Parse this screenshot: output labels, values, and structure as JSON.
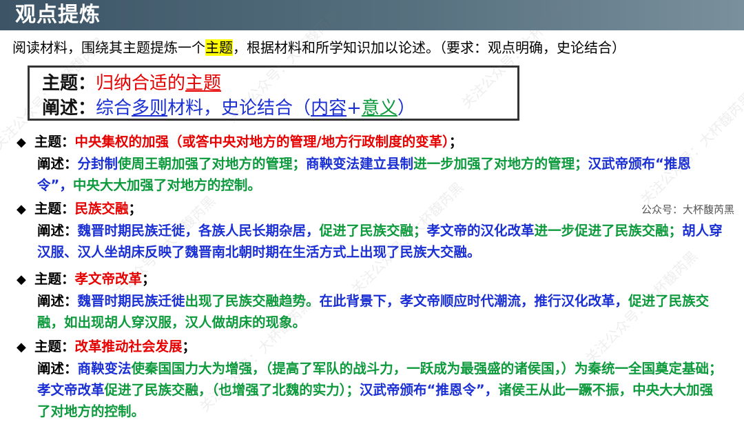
{
  "header": {
    "title": "观点提炼"
  },
  "intro": {
    "before": "阅读材料，围绕其主题提炼一个",
    "highlight": "主题",
    "after": "，根据材料和所学知识加以论述。（要求：观点明确，史论结合）"
  },
  "requirements_box": {
    "line1_label": "主题：",
    "line1_pre": "归纳合适的",
    "line1_underlined": "主题",
    "line2_label": "阐述：",
    "line2_a": "综合",
    "line2_b": "多则",
    "line2_c": "材料，史论结合（",
    "line2_d": "内容",
    "line2_e": "+",
    "line2_f": "意义",
    "line2_g": "）"
  },
  "points": [
    {
      "theme_label": "主题：",
      "theme": "中央集权的加强（或答中央对地方的管理/地方行政制度的变革）",
      "theme_end": "；",
      "explain_label": "阐述：",
      "segments": [
        {
          "t": "分封制",
          "c": "blue"
        },
        {
          "t": "使周王朝加强了对地方的管理；",
          "c": "green"
        },
        {
          "t": "商鞅变法建立县制",
          "c": "blue"
        },
        {
          "t": "进一步加强了对地方的管理；",
          "c": "green"
        },
        {
          "t": "汉武帝颁布“推恩令”，",
          "c": "blue"
        },
        {
          "t": "中央大大加强了对地方的控制。",
          "c": "green"
        }
      ]
    },
    {
      "theme_label": "主题：",
      "theme": "民族交融",
      "theme_end": "；",
      "explain_label": "阐述：",
      "segments": [
        {
          "t": "魏晋时期民族迁徙，各族人民长期杂居，",
          "c": "blue"
        },
        {
          "t": "促进了民族交融；",
          "c": "green"
        },
        {
          "t": "孝文帝的汉化改革",
          "c": "blue"
        },
        {
          "t": "进一步促进了民族交融；",
          "c": "green"
        },
        {
          "t": "胡人穿汉服、汉人坐胡床反映了魏晋南北朝时期在生活方式上出现了民族大交融。",
          "c": "blue"
        }
      ]
    },
    {
      "theme_label": "主题：",
      "theme": "孝文帝改革",
      "theme_end": "；",
      "explain_label": "阐述：",
      "segments": [
        {
          "t": "魏晋时期民族迁徙",
          "c": "blue"
        },
        {
          "t": "出现了民族交融趋势。",
          "c": "green"
        },
        {
          "t": "在此背景下，孝文帝顺应时代潮流，推行汉化改革，",
          "c": "blue"
        },
        {
          "t": "促进了民族交融，如出现胡人穿汉服，汉人做胡床的现象。",
          "c": "green"
        }
      ]
    },
    {
      "theme_label": "主题：",
      "theme": "改革推动社会发展",
      "theme_end": "；",
      "explain_label": "阐述：",
      "segments": [
        {
          "t": "商鞅变法",
          "c": "blue"
        },
        {
          "t": "使秦国国力大为增强，（提高了军队的战斗力，一跃成为最强盛的诸侯国，）为秦统一全国奠定基础；",
          "c": "green"
        },
        {
          "t": "孝文帝改革",
          "c": "blue"
        },
        {
          "t": "促进了民族交融，（也增强了北魏的实力）；",
          "c": "green"
        },
        {
          "t": "汉武帝颁布“推恩令”，",
          "c": "blue"
        },
        {
          "t": "诸侯王从此一蹶不振，中央大大加强了对地方的控制。",
          "c": "green"
        }
      ]
    }
  ],
  "watermark": {
    "text": "公众号：大杯馥芮黑",
    "repeat_text": "关注公众号：大杯馥芮黑"
  },
  "colors": {
    "red": "#e60000",
    "blue": "#1a2fd4",
    "green": "#0c9a3c",
    "title_bar": "#4a6374"
  }
}
